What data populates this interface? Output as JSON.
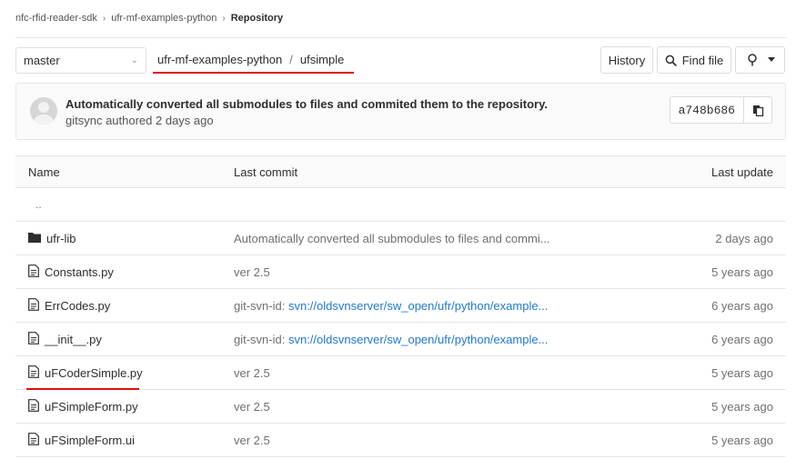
{
  "breadcrumb": {
    "items": [
      "nfc-rfid-reader-sdk",
      "ufr-mf-examples-python"
    ],
    "current": "Repository",
    "separator": "›"
  },
  "branch_selector": {
    "value": "master",
    "chevron": "⌄"
  },
  "path": {
    "project": "ufr-mf-examples-python",
    "separator": "/",
    "folder": "ufsimple"
  },
  "toolbar": {
    "history_label": "History",
    "find_file_label": "Find file"
  },
  "commit": {
    "message": "Automatically converted all submodules to files and commited them to the repository.",
    "author": "gitsync",
    "meta_text": "gitsync authored 2 days ago",
    "sha": "a748b686"
  },
  "table": {
    "headers": {
      "name": "Name",
      "last_commit": "Last commit",
      "last_update": "Last update"
    },
    "parent_dir": "..",
    "rows": [
      {
        "name": "ufr-lib",
        "type": "folder",
        "commit_prefix": "Automatically converted all submodules to files and commi...",
        "commit_link": "",
        "date": "2 days ago"
      },
      {
        "name": "Constants.py",
        "type": "file",
        "commit_prefix": "ver 2.5",
        "commit_link": "",
        "date": "5 years ago"
      },
      {
        "name": "ErrCodes.py",
        "type": "file",
        "commit_prefix": "git-svn-id: ",
        "commit_link": "svn://oldsvnserver/sw_open/ufr/python/example...",
        "date": "6 years ago"
      },
      {
        "name": "__init__.py",
        "type": "file",
        "commit_prefix": "git-svn-id: ",
        "commit_link": "svn://oldsvnserver/sw_open/ufr/python/example...",
        "date": "6 years ago"
      },
      {
        "name": "uFCoderSimple.py",
        "type": "file",
        "commit_prefix": "ver 2.5",
        "commit_link": "",
        "date": "5 years ago"
      },
      {
        "name": "uFSimpleForm.py",
        "type": "file",
        "commit_prefix": "ver 2.5",
        "commit_link": "",
        "date": "5 years ago"
      },
      {
        "name": "uFSimpleForm.ui",
        "type": "file",
        "commit_prefix": "ver 2.5",
        "commit_link": "",
        "date": "5 years ago"
      }
    ]
  },
  "colors": {
    "link": "#1f78d1",
    "highlight_underline": "#d9110f",
    "muted": "#707070"
  },
  "icons": {
    "folder": "folder-icon",
    "file": "file-icon",
    "search": "search-icon",
    "clone": "clone-icon",
    "copy": "copy-icon"
  }
}
